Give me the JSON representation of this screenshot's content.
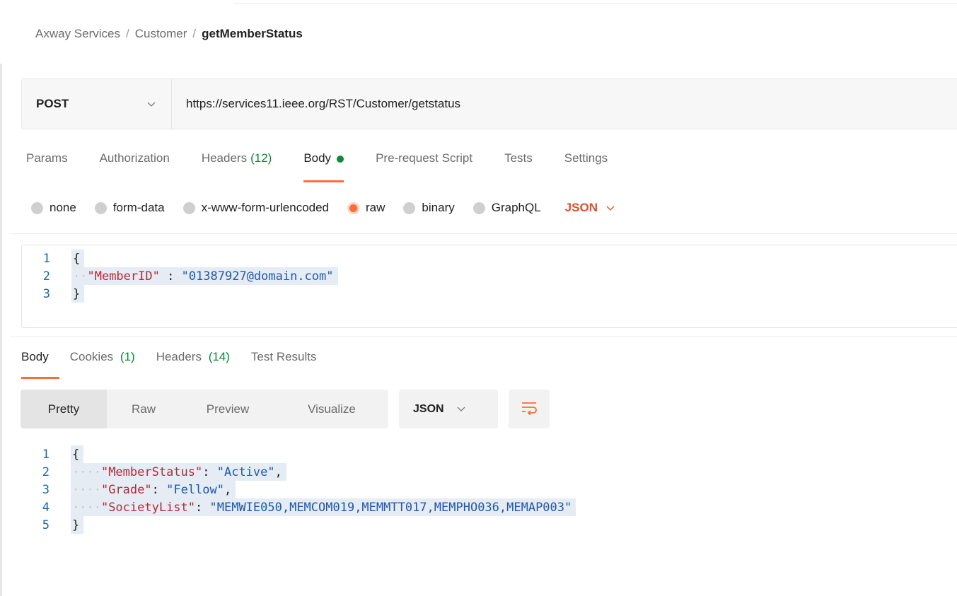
{
  "breadcrumb": {
    "items": [
      "Axway Services",
      "Customer"
    ],
    "separator": "/",
    "current": "getMemberStatus"
  },
  "request": {
    "method": "POST",
    "url": "https://services11.ieee.org/RST/Customer/getstatus"
  },
  "request_tabs": {
    "params": "Params",
    "authorization": "Authorization",
    "headers": "Headers",
    "headers_count": "(12)",
    "body": "Body",
    "pre_request": "Pre-request Script",
    "tests": "Tests",
    "settings": "Settings",
    "active": "Body"
  },
  "body_types": {
    "none": "none",
    "form_data": "form-data",
    "urlencoded": "x-www-form-urlencoded",
    "raw": "raw",
    "binary": "binary",
    "graphql": "GraphQL",
    "selected": "raw",
    "language": "JSON"
  },
  "request_body": {
    "line_numbers": [
      "1",
      "2",
      "3"
    ],
    "open": "{",
    "key": "\"MemberID\"",
    "sep": " : ",
    "value": "\"01387927@domain.com\"",
    "close": "}"
  },
  "response_tabs": {
    "body": "Body",
    "cookies": "Cookies",
    "cookies_count": "(1)",
    "headers": "Headers",
    "headers_count": "(14)",
    "test_results": "Test Results",
    "active": "Body"
  },
  "response_view": {
    "pretty": "Pretty",
    "raw": "Raw",
    "preview": "Preview",
    "visualize": "Visualize",
    "active": "Pretty",
    "format": "JSON"
  },
  "response_body": {
    "line_numbers": [
      "1",
      "2",
      "3",
      "4",
      "5"
    ],
    "open": "{",
    "close": "}",
    "fields": [
      {
        "key": "\"MemberStatus\"",
        "value": "\"Active\"",
        "trail": ","
      },
      {
        "key": "\"Grade\"",
        "value": "\"Fellow\"",
        "trail": ","
      },
      {
        "key": "\"SocietyList\"",
        "value": "\"MEMWIE050,MEMCOM019,MEMMTT017,MEMPHO036,MEMAP003\"",
        "trail": ""
      }
    ]
  },
  "colors": {
    "accent": "#ff6c37",
    "count_green": "#0a8a3a",
    "json_key": "#b6293a",
    "json_string": "#1c58b6",
    "line_number": "#1a6aa8"
  },
  "icons": {
    "method_dropdown": "chevron-down-icon",
    "language_dropdown": "chevron-down-icon",
    "format_dropdown": "chevron-down-icon",
    "wrap": "wrap-lines-icon",
    "body_indicator": "dot-icon"
  }
}
